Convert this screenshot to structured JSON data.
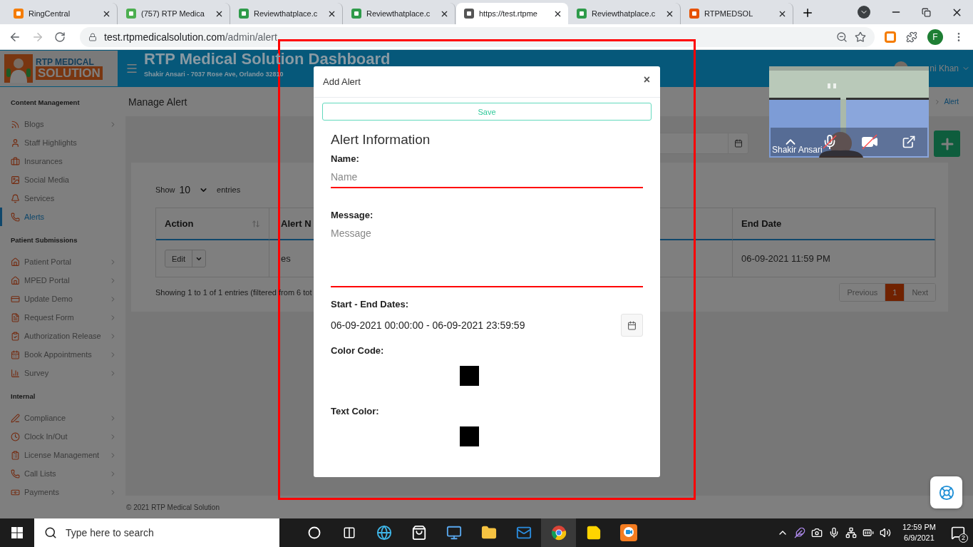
{
  "browser": {
    "tabs": [
      {
        "title": "RingCentral",
        "selected": false
      },
      {
        "title": "(757) RTP Medica",
        "selected": false
      },
      {
        "title": "Reviewthatplace.c",
        "selected": false
      },
      {
        "title": "Reviewthatplace.c",
        "selected": false
      },
      {
        "title": "https://test.rtpme",
        "selected": true
      },
      {
        "title": "Reviewthatplace.c",
        "selected": false
      },
      {
        "title": "RTPMEDSOL",
        "selected": false
      }
    ],
    "url": {
      "host": "test.rtpmedicalsolution.com",
      "path": "/admin/alert"
    },
    "profile_initial": "F"
  },
  "header": {
    "logo": {
      "line_1": "RTP MEDICAL",
      "line_2": "SOLUTION"
    },
    "title": "RTP Medical Solution Dashboard",
    "subtitle": "Shakir Ansari - 7037 Rose Ave, Orlando 32810",
    "user_name": "ni Khan"
  },
  "sidebar": {
    "sections": [
      {
        "title": "Content Management",
        "items": [
          {
            "label": "Blogs",
            "chevron": true,
            "selected": false
          },
          {
            "label": "Staff Highlights",
            "chevron": false,
            "selected": false
          },
          {
            "label": "Insurances",
            "chevron": false,
            "selected": false
          },
          {
            "label": "Social Media",
            "chevron": false,
            "selected": false
          },
          {
            "label": "Services",
            "chevron": false,
            "selected": false
          },
          {
            "label": "Alerts",
            "chevron": false,
            "selected": true
          }
        ]
      },
      {
        "title": "Patient Submissions",
        "items": [
          {
            "label": "Patient Portal",
            "chevron": true,
            "selected": false
          },
          {
            "label": "MPED Portal",
            "chevron": true,
            "selected": false
          },
          {
            "label": "Update Demo",
            "chevron": true,
            "selected": false
          },
          {
            "label": "Request Form",
            "chevron": true,
            "selected": false
          },
          {
            "label": "Authorization Release",
            "chevron": true,
            "selected": false
          },
          {
            "label": "Book Appointments",
            "chevron": true,
            "selected": false
          },
          {
            "label": "Survey",
            "chevron": true,
            "selected": false
          }
        ]
      },
      {
        "title": "Internal",
        "items": [
          {
            "label": "Compliance",
            "chevron": true,
            "selected": false
          },
          {
            "label": "Clock In/Out",
            "chevron": true,
            "selected": false
          },
          {
            "label": "License Management",
            "chevron": true,
            "selected": false
          },
          {
            "label": "Call Lists",
            "chevron": true,
            "selected": false
          },
          {
            "label": "Payments",
            "chevron": true,
            "selected": false
          }
        ]
      }
    ]
  },
  "page": {
    "title": "Manage Alert",
    "breadcrumb": "Alert"
  },
  "table": {
    "show_label": "Show",
    "page_size": "10",
    "entries_label": "entries",
    "columns": [
      "Action",
      "Alert N",
      "End Date"
    ],
    "rows": [
      {
        "action": "Edit",
        "alert_name": "es",
        "end_date": "06-09-2021 11:59 PM"
      }
    ],
    "info": "Showing 1 to 1 of 1 entries (filtered from 6 tot",
    "pagination": [
      {
        "label": "Previous",
        "selected": false
      },
      {
        "label": "1",
        "selected": true
      },
      {
        "label": "Next",
        "selected": false
      }
    ]
  },
  "footer": "© 2021 RTP Medical Solution",
  "modal": {
    "title": "Add Alert",
    "close": "×",
    "save": "Save",
    "section_title": "Alert Information",
    "fields": [
      {
        "kind": "text",
        "label": "Name:",
        "placeholder": "Name"
      },
      {
        "kind": "textarea",
        "label": "Message:",
        "placeholder": "Message"
      },
      {
        "kind": "daterange",
        "label": "Start - End Dates:",
        "value": "06-09-2021 00:00:00 - 06-09-2021 23:59:59"
      },
      {
        "kind": "color",
        "label": "Color Code:",
        "color": "#000000"
      },
      {
        "kind": "color",
        "label": "Text Color:",
        "color": "#000000"
      }
    ]
  },
  "video_call": {
    "name": "Shakir Ansari",
    "muted": true,
    "camera_off": true
  },
  "taskbar": {
    "search_placeholder": "Type here to search",
    "time": "12:59 PM",
    "date": "6/9/2021",
    "notifications": "2"
  }
}
